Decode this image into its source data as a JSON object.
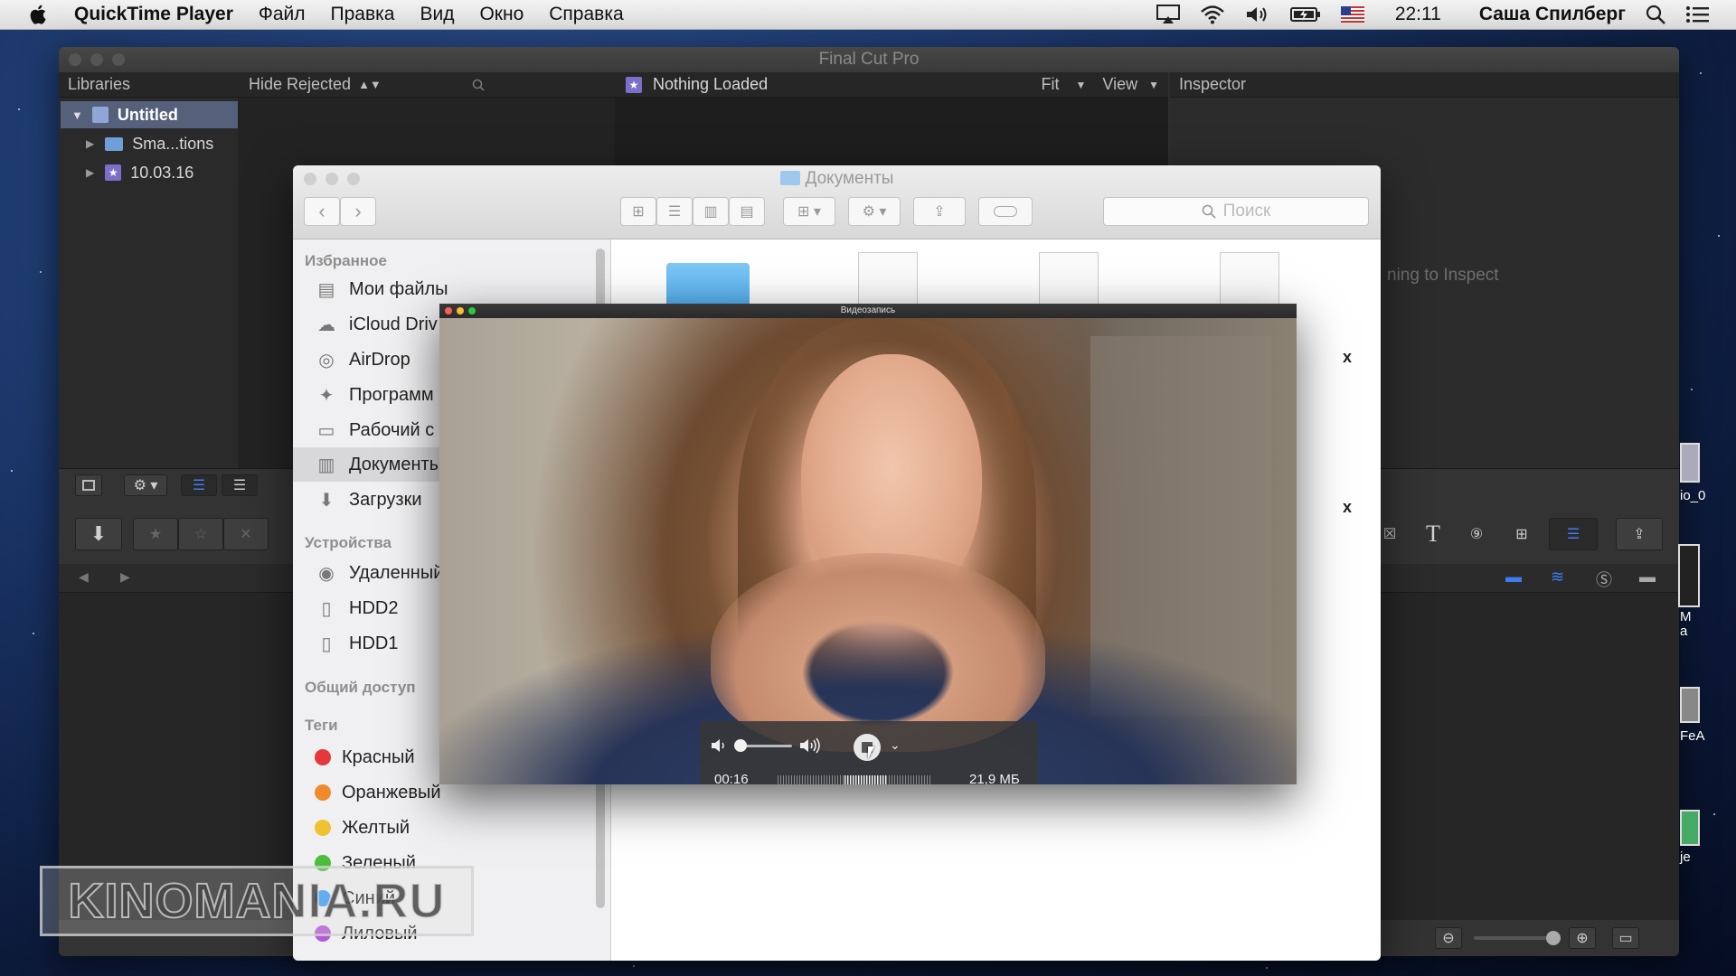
{
  "menubar": {
    "app_name": "QuickTime Player",
    "menus": [
      "Файл",
      "Правка",
      "Вид",
      "Окно",
      "Справка"
    ],
    "clock": "22:11",
    "user": "Саша Спилберг"
  },
  "fcp": {
    "title": "Final Cut Pro",
    "libraries_header": "Libraries",
    "filter_label": "Hide Rejected",
    "library_items": [
      "Untitled",
      "Sma...tions",
      "10.03.16"
    ],
    "viewer_title": "Nothing Loaded",
    "fit_label": "Fit",
    "view_label": "View",
    "inspector_header": "Inspector",
    "inspector_empty": "ning to Inspect",
    "right_partial": [
      "io_0",
      "M",
      "a",
      "FeA",
      "je"
    ]
  },
  "finder": {
    "title": "Документы",
    "search_placeholder": "Поиск",
    "section_favorites": "Избранное",
    "favorites": [
      "Мои файлы",
      "iCloud Driv",
      "AirDrop",
      "Программ",
      "Рабочий с",
      "Документы",
      "Загрузки"
    ],
    "section_devices": "Устройства",
    "devices": [
      "Удаленный",
      "HDD2",
      "HDD1"
    ],
    "section_shared": "Общий доступ",
    "section_tags": "Теги",
    "tags": [
      {
        "label": "Красный",
        "color": "#e5373c"
      },
      {
        "label": "Оранжевый",
        "color": "#f08a2b"
      },
      {
        "label": "Желтый",
        "color": "#eec231"
      },
      {
        "label": "Зеленый",
        "color": "#4cbe3c"
      },
      {
        "label": "Синий",
        "color": "#3a9ef3"
      },
      {
        "label": "Лиловый",
        "color": "#b35ad6"
      }
    ],
    "file_suffixes": [
      "x",
      "x"
    ]
  },
  "quicktime": {
    "title": "Видеозапись",
    "time": "00:16",
    "size": "21,9 МБ",
    "volume": 0.0
  },
  "watermark": "KINOMANIA.RU"
}
